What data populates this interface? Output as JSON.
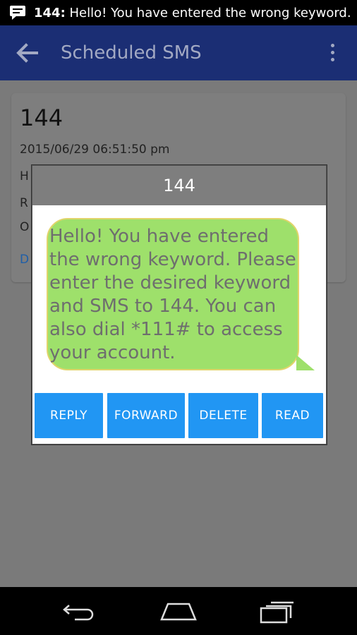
{
  "status_bar": {
    "ticker_sender": "144:",
    "ticker_text": " Hello! You have entered the wrong keyword."
  },
  "app_bar": {
    "title": "Scheduled SMS"
  },
  "card": {
    "number": "144",
    "date": "2015/06/29 06:51:50 pm",
    "peek_lines": [
      "H",
      "R",
      "O",
      "D"
    ]
  },
  "dialog": {
    "title": "144",
    "message": "Hello! You have entered the wrong keyword. Please enter the desired keyword and SMS to 144. You can also dial *111# to access your account.",
    "buttons": {
      "reply": "REPLY",
      "forward": "FORWARD",
      "delete": "DELETE",
      "read": "READ"
    }
  },
  "colors": {
    "app_bar": "#1b2e74",
    "bubble": "#9ee06b",
    "bubble_border": "#e0d46a",
    "button": "#2196f3",
    "dim_overlay": "#7a7a7a"
  }
}
